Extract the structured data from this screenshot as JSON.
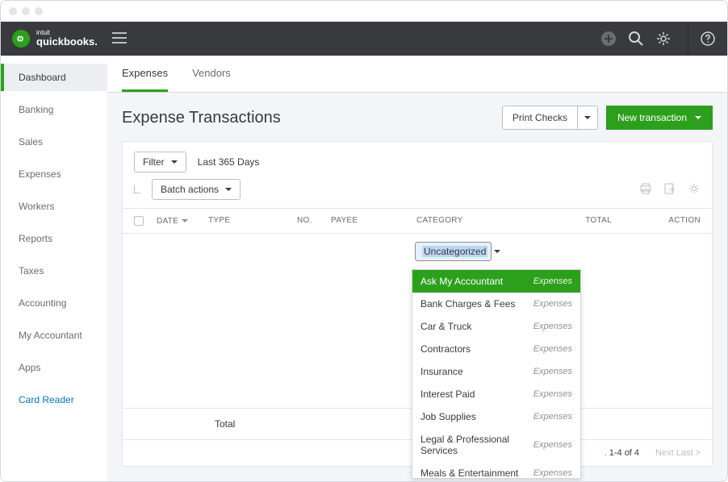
{
  "brand": {
    "intuit": "intuit",
    "name": "quickbooks."
  },
  "sidebar": {
    "items": [
      {
        "label": "Dashboard",
        "active": true
      },
      {
        "label": "Banking"
      },
      {
        "label": "Sales"
      },
      {
        "label": "Expenses"
      },
      {
        "label": "Workers"
      },
      {
        "label": "Reports"
      },
      {
        "label": "Taxes"
      },
      {
        "label": "Accounting"
      },
      {
        "label": "My Accountant"
      },
      {
        "label": "Apps"
      },
      {
        "label": "Card Reader",
        "link": true
      }
    ]
  },
  "tabs": [
    {
      "label": "Expenses",
      "active": true
    },
    {
      "label": "Vendors"
    }
  ],
  "page": {
    "title": "Expense Transactions"
  },
  "header_actions": {
    "print_checks": "Print Checks",
    "new_transaction": "New transaction"
  },
  "toolbar": {
    "filter": "Filter",
    "date_range": "Last 365 Days",
    "batch": "Batch actions"
  },
  "columns": {
    "date": "DATE",
    "type": "TYPE",
    "no": "NO.",
    "payee": "PAYEE",
    "category": "CATEGORY",
    "total": "TOTAL",
    "action": "ACTION"
  },
  "category_selector": {
    "value": "Uncategorized"
  },
  "dropdown": {
    "options": [
      {
        "label": "Ask My Accountant",
        "type": "Expenses",
        "highlighted": true
      },
      {
        "label": "Bank Charges & Fees",
        "type": "Expenses"
      },
      {
        "label": "Car & Truck",
        "type": "Expenses"
      },
      {
        "label": "Contractors",
        "type": "Expenses"
      },
      {
        "label": "Insurance",
        "type": "Expenses"
      },
      {
        "label": "Interest Paid",
        "type": "Expenses"
      },
      {
        "label": "Job Supplies",
        "type": "Expenses"
      },
      {
        "label": "Legal & Professional Services",
        "type": "Expenses"
      },
      {
        "label": "Meals & Entertainment",
        "type": "Expenses"
      }
    ]
  },
  "totals": {
    "label": "Total"
  },
  "footer": {
    "range": "1-4 of 4",
    "next": "Next Last >"
  }
}
